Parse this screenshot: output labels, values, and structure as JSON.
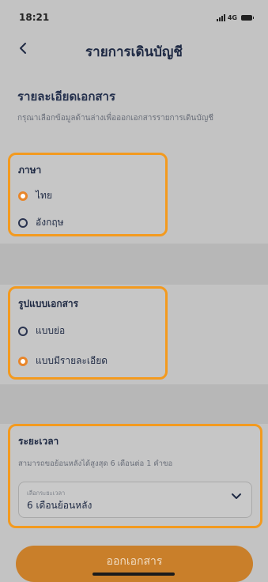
{
  "status_bar": {
    "time": "18:21",
    "network": "4G"
  },
  "nav": {
    "back_icon": "chevron-left-icon",
    "title": "รายการเดินบัญชี"
  },
  "intro": {
    "title": "รายละเอียดเอกสาร",
    "subtitle": "กรุณาเลือกข้อมูลด้านล่างเพื่อออกเอกสารรายการเดินบัญชี"
  },
  "language": {
    "title": "ภาษา",
    "options": [
      {
        "label": "ไทย",
        "selected": true
      },
      {
        "label": "อังกฤษ",
        "selected": false
      }
    ]
  },
  "document_format": {
    "title": "รูปแบบเอกสาร",
    "options": [
      {
        "label": "แบบย่อ",
        "selected": false
      },
      {
        "label": "แบบมีรายละเอียด",
        "selected": true
      }
    ]
  },
  "period": {
    "title": "ระยะเวลา",
    "subtitle": "สามารถขอย้อนหลังได้สูงสุด 6 เดือนต่อ 1 คำขอ",
    "select_caption": "เลือกระยะเวลา",
    "select_value": "6 เดือนย้อนหลัง"
  },
  "submit_label": "ออกเอกสาร",
  "colors": {
    "accent": "#f39a1f",
    "button": "#c97f2a",
    "text": "#1f2a44"
  }
}
